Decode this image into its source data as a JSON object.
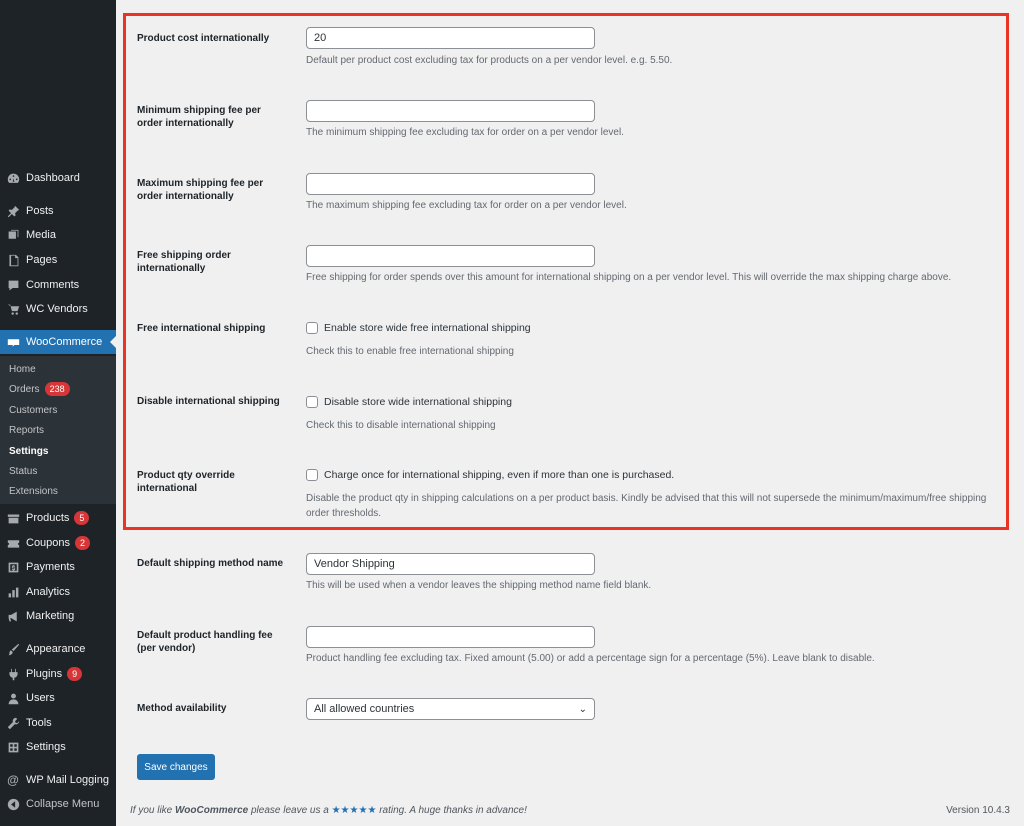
{
  "sidebar": {
    "items": [
      {
        "label": "Dashboard",
        "icon": "dashboard-icon"
      },
      {
        "label": "Posts",
        "icon": "pin-icon"
      },
      {
        "label": "Media",
        "icon": "media-icon"
      },
      {
        "label": "Pages",
        "icon": "page-icon"
      },
      {
        "label": "Comments",
        "icon": "comment-icon"
      },
      {
        "label": "WC Vendors",
        "icon": "cart-icon"
      },
      {
        "label": "WooCommerce",
        "icon": "woo-icon"
      },
      {
        "label": "Products",
        "icon": "archive-icon",
        "badge": "5"
      },
      {
        "label": "Coupons",
        "icon": "ticket-icon",
        "badge": "2"
      },
      {
        "label": "Payments",
        "icon": "dollar-icon"
      },
      {
        "label": "Analytics",
        "icon": "chart-icon"
      },
      {
        "label": "Marketing",
        "icon": "megaphone-icon"
      },
      {
        "label": "Appearance",
        "icon": "brush-icon"
      },
      {
        "label": "Plugins",
        "icon": "plug-icon",
        "badge": "9"
      },
      {
        "label": "Users",
        "icon": "user-icon"
      },
      {
        "label": "Tools",
        "icon": "wrench-icon"
      },
      {
        "label": "Settings",
        "icon": "settings-icon"
      },
      {
        "label": "WP Mail Logging",
        "icon": "at-icon"
      },
      {
        "label": "Collapse Menu",
        "icon": "collapse-icon"
      }
    ],
    "submenu": [
      {
        "label": "Home"
      },
      {
        "label": "Orders",
        "badge": "238"
      },
      {
        "label": "Customers"
      },
      {
        "label": "Reports"
      },
      {
        "label": "Settings"
      },
      {
        "label": "Status"
      },
      {
        "label": "Extensions"
      }
    ]
  },
  "form": {
    "product_cost": {
      "label": "Product cost internationally",
      "value": "20",
      "desc": "Default per product cost excluding tax for products on a per vendor level. e.g. 5.50."
    },
    "min_fee": {
      "label": "Minimum shipping fee per order internationally",
      "value": "",
      "desc": "The minimum shipping fee excluding tax for order on a per vendor level."
    },
    "max_fee": {
      "label": "Maximum shipping fee per order internationally",
      "value": "",
      "desc": "The maximum shipping fee excluding tax for order on a per vendor level."
    },
    "free_order": {
      "label": "Free shipping order internationally",
      "value": "",
      "desc": "Free shipping for order spends over this amount for international shipping on a per vendor level. This will override the max shipping charge above."
    },
    "free_intl": {
      "label": "Free international shipping",
      "checkbox": "Enable store wide free international shipping",
      "desc": "Check this to enable free international shipping"
    },
    "disable_intl": {
      "label": "Disable international shipping",
      "checkbox": "Disable store wide international shipping",
      "desc": "Check this to disable international shipping"
    },
    "qty_override": {
      "label": "Product qty override international",
      "checkbox": "Charge once for international shipping, even if more than one is purchased.",
      "desc": "Disable the product qty in shipping calculations on a per product basis. Kindly be advised that this will not supersede the minimum/maximum/free shipping order thresholds."
    },
    "method_name": {
      "label": "Default shipping method name",
      "value": "Vendor Shipping",
      "desc": "This will be used when a vendor leaves the shipping method name field blank."
    },
    "handling_fee": {
      "label": "Default product handling fee (per vendor)",
      "value": "",
      "desc": "Product handling fee excluding tax. Fixed amount (5.00) or add a percentage sign for a percentage (5%). Leave blank to disable."
    },
    "availability": {
      "label": "Method availability",
      "selected": "All allowed countries"
    },
    "save_label": "Save changes"
  },
  "footer": {
    "pre": "If you like ",
    "brand": "WooCommerce",
    "mid": " please leave us a ",
    "stars": "★★★★★",
    "post": " rating. A huge thanks in advance!",
    "version": "Version 10.4.3"
  },
  "colors": {
    "sidebar_bg": "#1d2327",
    "accent": "#2271b1",
    "highlight": "#ea3323",
    "badge": "#d63638"
  }
}
